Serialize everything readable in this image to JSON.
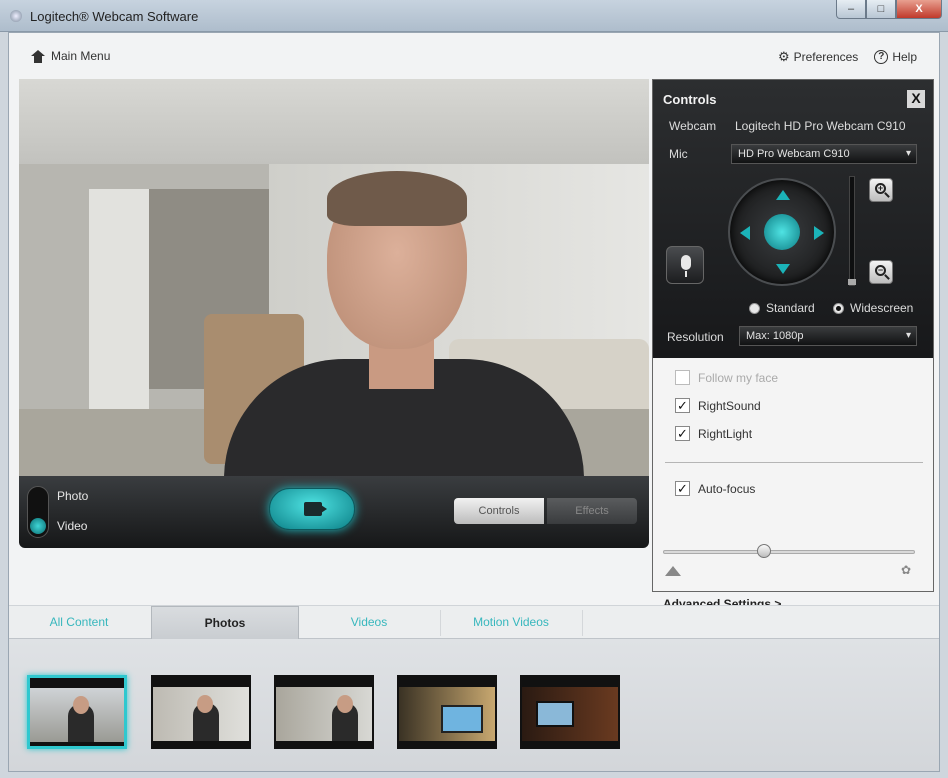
{
  "window": {
    "title": "Logitech® Webcam Software",
    "buttons": {
      "minimize": "–",
      "maximize": "□",
      "close": "X"
    }
  },
  "topnav": {
    "main_menu": "Main Menu",
    "preferences": "Preferences",
    "help": "Help",
    "icons": {
      "main_menu": "home-icon",
      "preferences": "gear-icon",
      "help": "help-icon"
    }
  },
  "capture": {
    "mode_photo": "Photo",
    "mode_video": "Video",
    "selected_mode": "Video",
    "tab_controls": "Controls",
    "tab_effects": "Effects",
    "record_icon": "video-camera-icon"
  },
  "controls_panel": {
    "title": "Controls",
    "close": "X",
    "webcam_label": "Webcam",
    "webcam_value": "Logitech HD Pro Webcam C910",
    "mic_label": "Mic",
    "mic_value": "HD Pro Webcam C910",
    "aspect_options": [
      "Standard",
      "Widescreen"
    ],
    "aspect_selected": "Widescreen",
    "resolution_label": "Resolution",
    "resolution_value": "Max: 1080p",
    "follow_face": {
      "label": "Follow my face",
      "checked": false,
      "enabled": false
    },
    "rightsound": {
      "label": "RightSound",
      "checked": true
    },
    "rightlight": {
      "label": "RightLight",
      "checked": true
    },
    "autofocus": {
      "label": "Auto-focus",
      "checked": true
    },
    "focus_level": 0.4,
    "advanced_link": "Advanced Settings >"
  },
  "gallery": {
    "tabs": [
      "All Content",
      "Photos",
      "Videos",
      "Motion Videos"
    ],
    "active_tab": "Photos",
    "thumbnail_count": 5,
    "selected_thumbnail": 0
  },
  "colors": {
    "accent": "#2fc8cf",
    "panel_dark": "#1d1e20",
    "tab_inactive_text": "#37b7bd"
  }
}
